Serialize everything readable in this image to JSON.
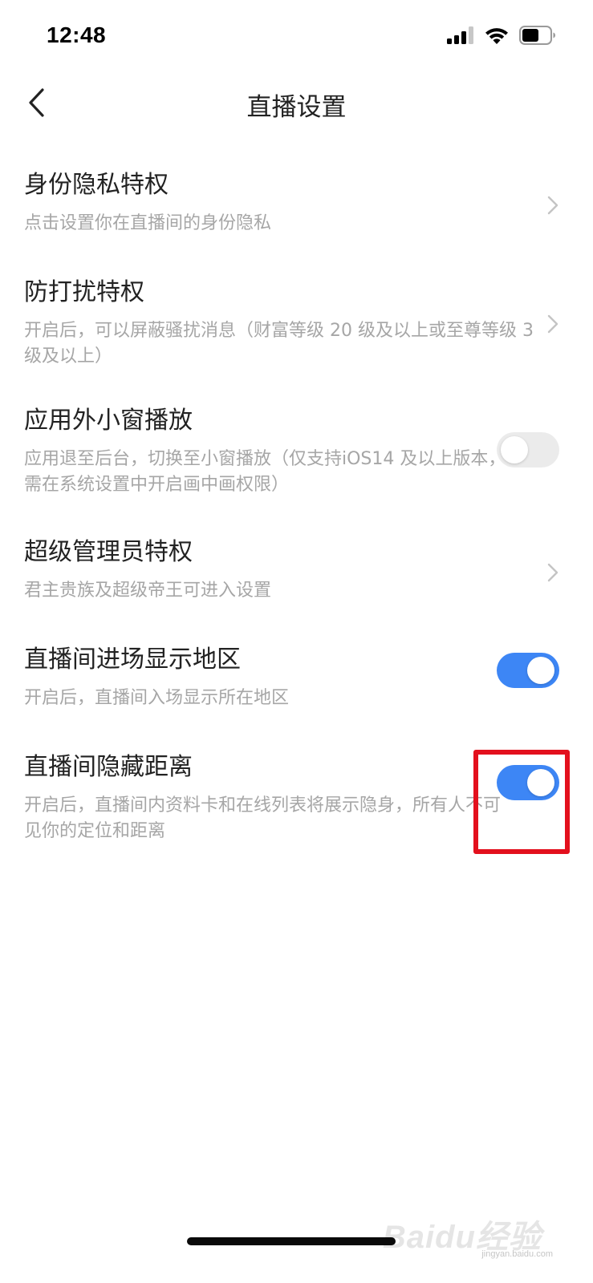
{
  "status_bar": {
    "time": "12:48",
    "icons": [
      "cellular-signal-icon",
      "wifi-icon",
      "battery-icon"
    ]
  },
  "nav": {
    "title": "直播设置",
    "back_icon": "chevron-left-icon"
  },
  "settings": [
    {
      "title": "身份隐私特权",
      "description": "点击设置你在直播间的身份隐私",
      "control": "chevron-right-icon"
    },
    {
      "title": "防打扰特权",
      "description": "开启后，可以屏蔽骚扰消息（财富等级 20 级及以上或至尊等级 3 级及以上）",
      "control": "chevron-right-icon"
    },
    {
      "title": "应用外小窗播放",
      "description": "应用退至后台，切换至小窗播放（仅支持iOS14 及以上版本，需在系统设置中开启画中画权限）",
      "control": "toggle",
      "enabled": false
    },
    {
      "title": "超级管理员特权",
      "description": "君主贵族及超级帝王可进入设置",
      "control": "chevron-right-icon"
    },
    {
      "title": "直播间进场显示地区",
      "description": "开启后，直播间入场显示所在地区",
      "control": "toggle",
      "enabled": true
    },
    {
      "title": "直播间隐藏距离",
      "description": "开启后，直播间内资料卡和在线列表将展示隐身，所有人不可见你的定位和距离",
      "control": "toggle",
      "enabled": true
    }
  ],
  "colors": {
    "toggle_on": "#3d86f5",
    "toggle_off": "#ebebeb",
    "highlight": "#e3101d",
    "text_primary": "#222222",
    "text_secondary": "#a6a6a6"
  },
  "watermark": {
    "logo": "Baidu经验",
    "url": "jingyan.baidu.com"
  }
}
